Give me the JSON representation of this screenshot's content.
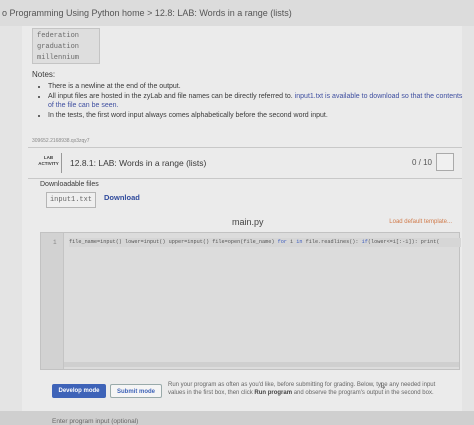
{
  "breadcrumb": "o Programming Using Python home > 12.8: LAB: Words in a range (lists)",
  "output_lines": [
    "federation",
    "graduation",
    "millennium"
  ],
  "notes": {
    "title": "Notes:",
    "items": [
      "There is a newline at the end of the output.",
      "All input files are hosted in the zyLab and file names can be directly referred to.",
      "In the tests, the first word input always comes alphabetically before the second word input."
    ],
    "item2_highlight": "input1.txt is available to download so that the contents of the file can be seen."
  },
  "activity_id": "309652.2168938.qx3zqy7",
  "lab": {
    "badge_line1": "LAB",
    "badge_line2": "ACTIVITY",
    "title": "12.8.1: LAB: Words in a range (lists)",
    "score": "0 / 10"
  },
  "downloads": {
    "title": "Downloadable files",
    "file": "input1.txt",
    "download_label": "Download"
  },
  "editor": {
    "filename": "main.py",
    "load_template": "Load default template...",
    "line_number": "1",
    "code_a": "file_name=input() lower=input() upper=input() file=open(file_name) ",
    "code_kw1": "for",
    "code_b": " i ",
    "code_kw2": "in",
    "code_c": " file.readlines(): ",
    "code_kw3": "if",
    "code_d": "(lower<=i[:-1]): print("
  },
  "actions": {
    "develop": "Develop mode",
    "submit": "Submit mode",
    "note_a": "Run your program as often as you'd like, before submitting for grading. Below, type any needed input values in the first box, then click ",
    "note_bold": "Run program",
    "note_b": " and observe the program's output in the second box."
  },
  "input_label": "Enter program input (optional)"
}
